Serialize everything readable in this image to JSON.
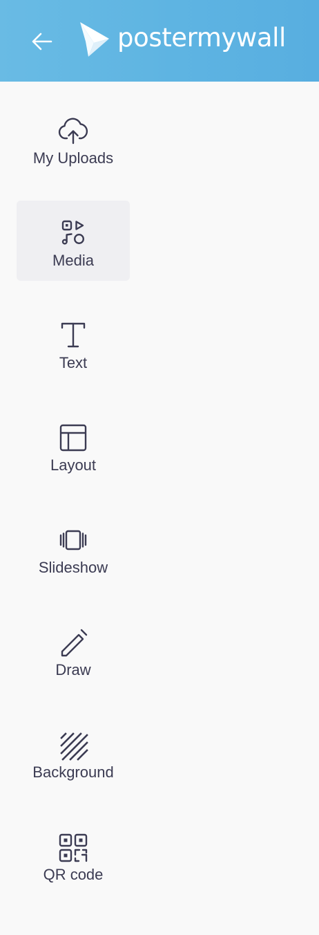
{
  "header": {
    "back_icon": "arrow-left-icon",
    "logo_icon": "postermywall-logo-mark",
    "logo_text": "postermywall",
    "brand_color": "#5eb4e2"
  },
  "nav": {
    "selected": "Media",
    "items": [
      {
        "label": "My Uploads",
        "icon": "cloud-upload-icon"
      },
      {
        "label": "Media",
        "icon": "media-icon"
      },
      {
        "label": "Text",
        "icon": "text-icon"
      },
      {
        "label": "Layout",
        "icon": "layout-icon"
      },
      {
        "label": "Slideshow",
        "icon": "slideshow-icon"
      },
      {
        "label": "Draw",
        "icon": "pencil-icon"
      },
      {
        "label": "Background",
        "icon": "background-hatch-icon"
      },
      {
        "label": "QR code",
        "icon": "qr-code-icon"
      }
    ]
  }
}
